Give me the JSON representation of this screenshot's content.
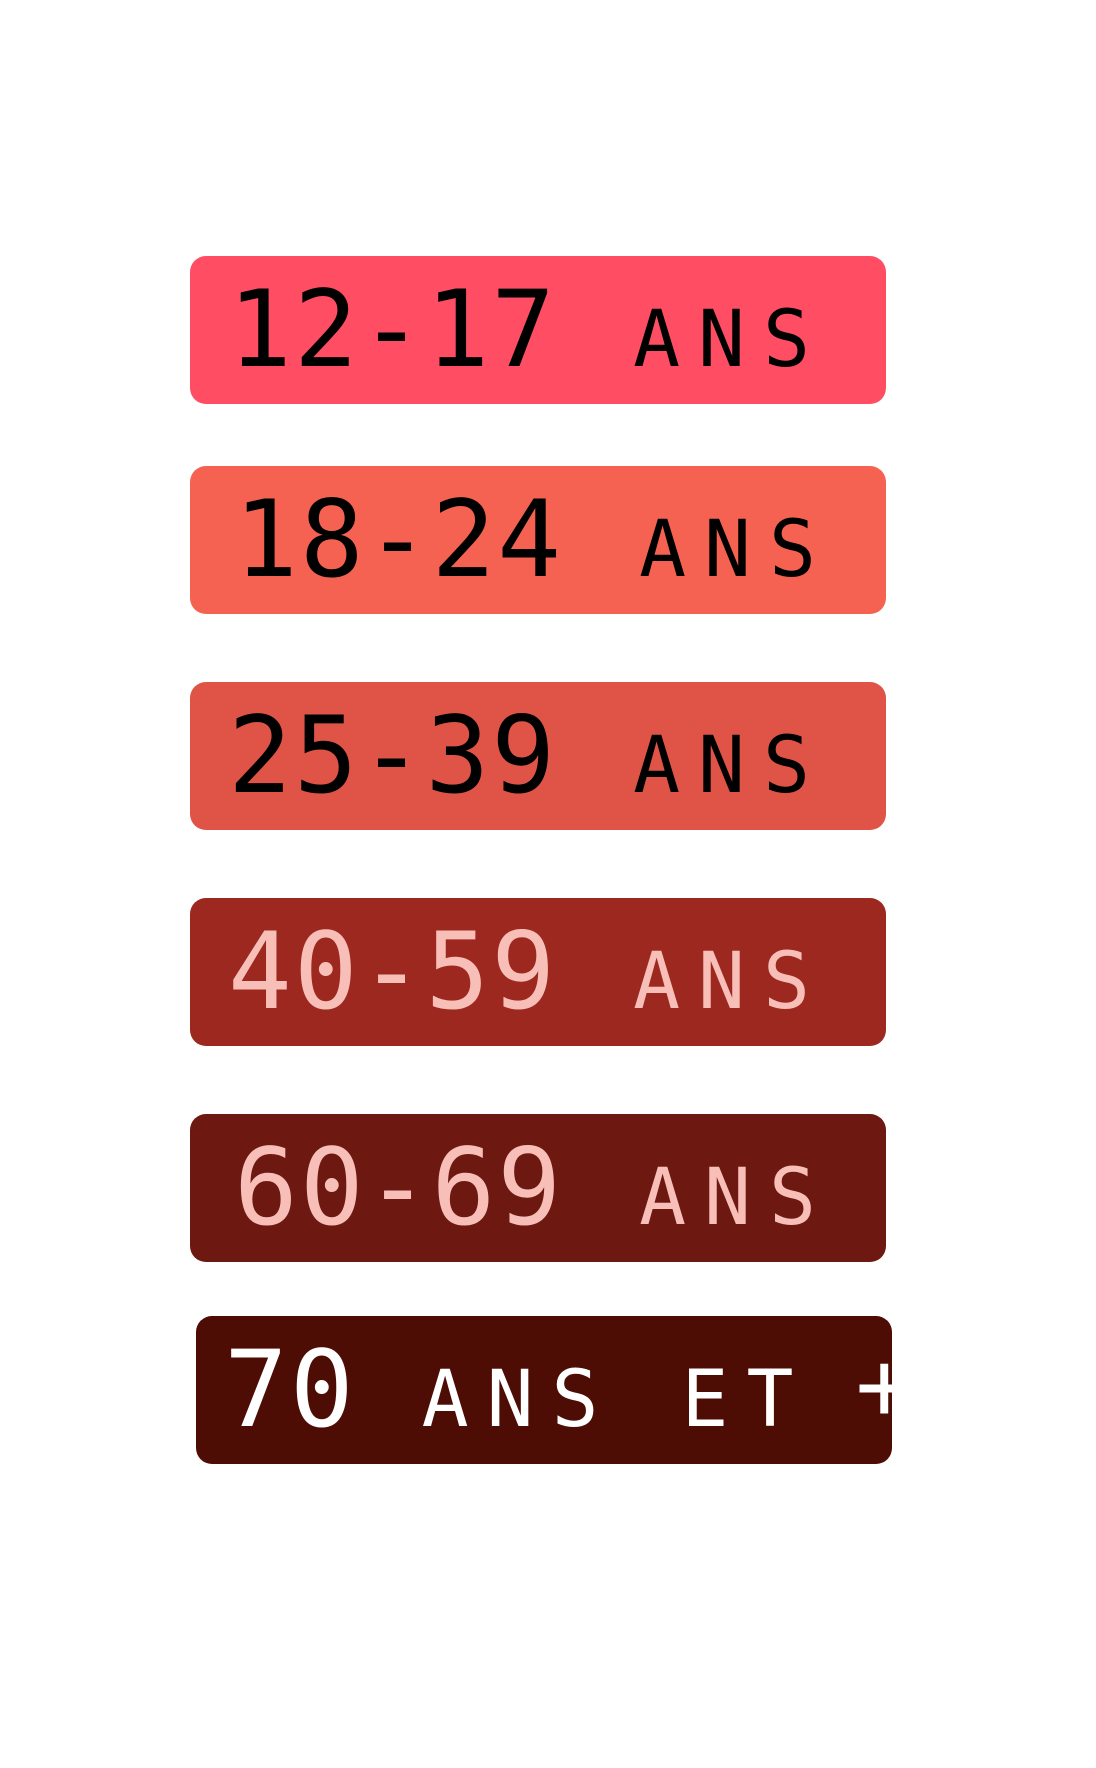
{
  "age_groups": [
    {
      "range": "12-17",
      "unit": "ANS",
      "bg": "#ff4d63",
      "fg": "#000000"
    },
    {
      "range": "18-24",
      "unit": "ANS",
      "bg": "#f56251",
      "fg": "#000000"
    },
    {
      "range": "25-39",
      "unit": "ANS",
      "bg": "#e05447",
      "fg": "#000000"
    },
    {
      "range": "40-59",
      "unit": "ANS",
      "bg": "#9d281f",
      "fg": "#f7bfb8"
    },
    {
      "range": "60-69",
      "unit": "ANS",
      "bg": "#6d1912",
      "fg": "#f7bfb8"
    }
  ],
  "last_group": {
    "range": "70",
    "unit": "ANS ET",
    "plus": "+",
    "bg": "#4d0d04",
    "fg": "#ffffff"
  }
}
